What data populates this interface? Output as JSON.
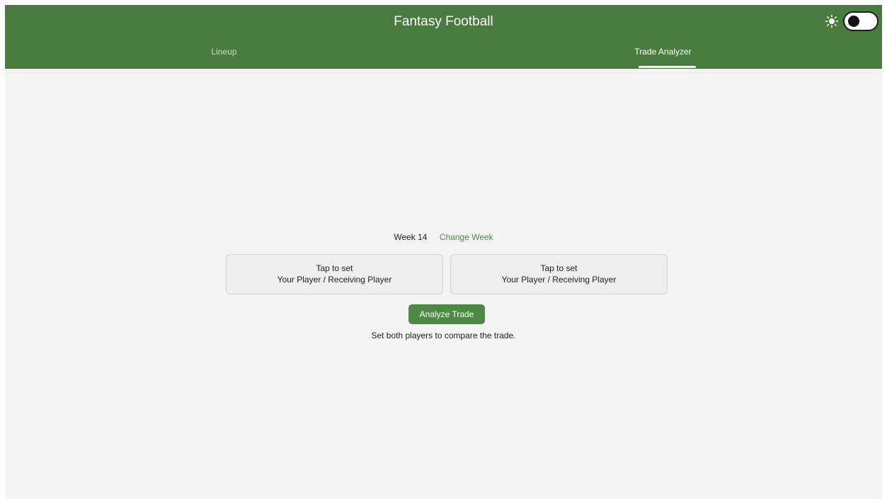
{
  "app": {
    "title": "Fantasy Football",
    "colors": {
      "header": "#477c3e",
      "accent": "#4b8b43",
      "background": "#f4f4f4"
    },
    "theme_toggle": {
      "icon": "sun-icon",
      "state": "off"
    }
  },
  "tabs": [
    {
      "label": "Lineup",
      "selected": false
    },
    {
      "label": "Trade Analyzer",
      "selected": true
    }
  ],
  "trade": {
    "week_label": "Week 14",
    "change_week_label": "Change Week",
    "slots": [
      {
        "line1": "Tap to set",
        "line2": "Your Player / Receiving Player"
      },
      {
        "line1": "Tap to set",
        "line2": "Your Player / Receiving Player"
      }
    ],
    "analyze_label": "Analyze Trade",
    "hint": "Set both players to compare the trade."
  }
}
